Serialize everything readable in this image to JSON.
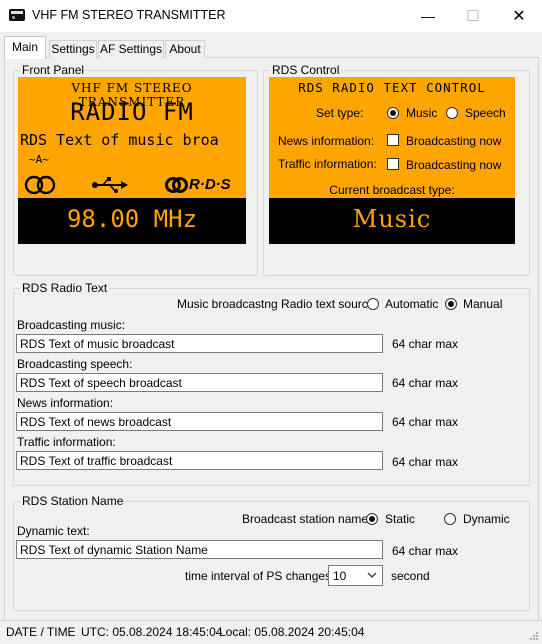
{
  "window": {
    "title": "VHF FM STEREO TRANSMITTER",
    "minimize": "—",
    "maximize": "☐",
    "close": "✕"
  },
  "tabs": [
    "Main",
    "Settings",
    "AF Settings",
    "About"
  ],
  "front_panel": {
    "group_label": "Front Panel",
    "header": "VHF FM STEREO TRANSMITTER",
    "name": "RADIO FM",
    "rds_text": "RDS Text of music broa",
    "af_indicator": "~A~",
    "rds_logo": "R·D·S",
    "frequency": "98.00 MHz",
    "colors": {
      "display": "#ffa500",
      "lcd_bg": "#000000"
    },
    "icons": [
      "stereo-icon",
      "usb-icon",
      "rds-logo-icon"
    ]
  },
  "rds_control": {
    "group_label": "RDS Control",
    "header": "RDS RADIO TEXT CONTROL",
    "set_type_label": "Set type:",
    "type_options": [
      "Music",
      "Speech"
    ],
    "selected_type": "Music",
    "news_label": "News information:",
    "traffic_label": "Traffic information:",
    "broadcasting_now": "Broadcasting now",
    "news_checked": false,
    "traffic_checked": false,
    "current_type_label": "Current broadcast type:",
    "current_type_value": "Music"
  },
  "radio_text": {
    "group_label": "RDS Radio Text",
    "source_label": "Music broadcastng Radio text source:",
    "source_options": [
      "Automatic",
      "Manual"
    ],
    "selected_source": "Manual",
    "fields": [
      {
        "label": "Broadcasting music:",
        "value": "RDS Text of music broadcast",
        "hint": "64 char max"
      },
      {
        "label": "Broadcasting speech:",
        "value": "RDS Text of speech broadcast",
        "hint": "64 char max"
      },
      {
        "label": "News information:",
        "value": "RDS Text of news broadcast",
        "hint": "64 char max"
      },
      {
        "label": "Traffic information:",
        "value": "RDS Text of traffic broadcast",
        "hint": "64 char max"
      }
    ]
  },
  "station_name": {
    "group_label": "RDS Station Name",
    "mode_label": "Broadcast station name:",
    "mode_options": [
      "Static",
      "Dynamic"
    ],
    "selected_mode": "Static",
    "dynamic_label": "Dynamic text:",
    "dynamic_value": "RDS Text of dynamic Station Name",
    "dynamic_hint": "64 char max",
    "interval_label": "time interval of PS changes:",
    "interval_value": "10",
    "interval_unit": "second"
  },
  "status_bar": {
    "label": "DATE / TIME",
    "utc": "UTC: 05.08.2024 18:45:04",
    "local": "Local: 05.08.2024 20:45:04"
  }
}
